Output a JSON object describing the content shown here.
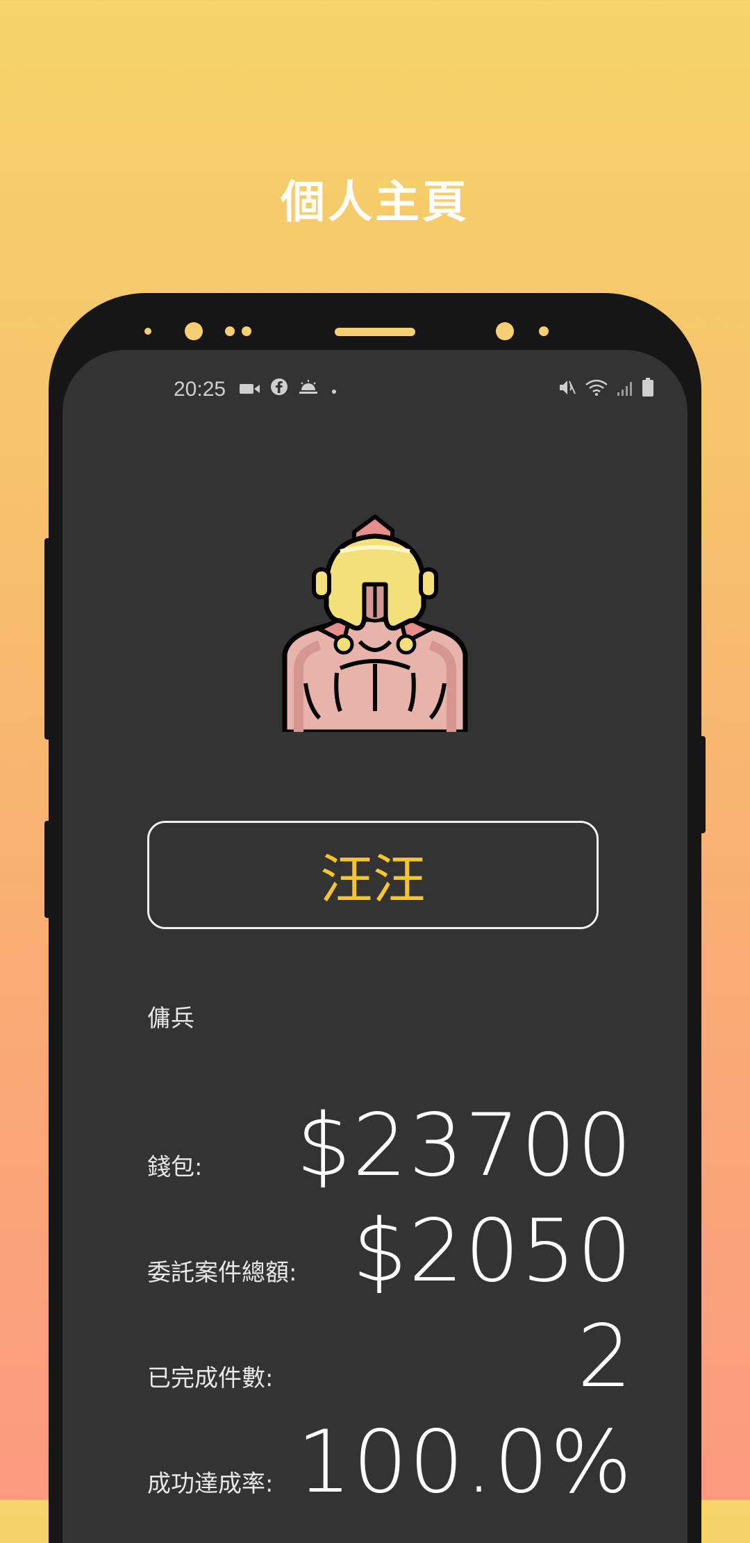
{
  "page_title": "個人主頁",
  "status_bar": {
    "time": "20:25",
    "left_icons": [
      "video-icon",
      "facebook-icon",
      "weather-icon",
      "dot-icon"
    ],
    "right_icons": [
      "mute-icon",
      "wifi-icon",
      "signal-icon",
      "battery-icon"
    ]
  },
  "profile": {
    "avatar": "spartan-warrior-avatar",
    "name": "汪汪",
    "role": "傭兵"
  },
  "stats": [
    {
      "label": "錢包:",
      "value": "$23700"
    },
    {
      "label": "委託案件總額:",
      "value": "$2050"
    },
    {
      "label": "已完成件數:",
      "value": "2"
    },
    {
      "label": "成功達成率:",
      "value": "100.0%"
    }
  ],
  "colors": {
    "accent": "#f4c531",
    "screen_bg": "#323332",
    "frame": "#161616"
  }
}
